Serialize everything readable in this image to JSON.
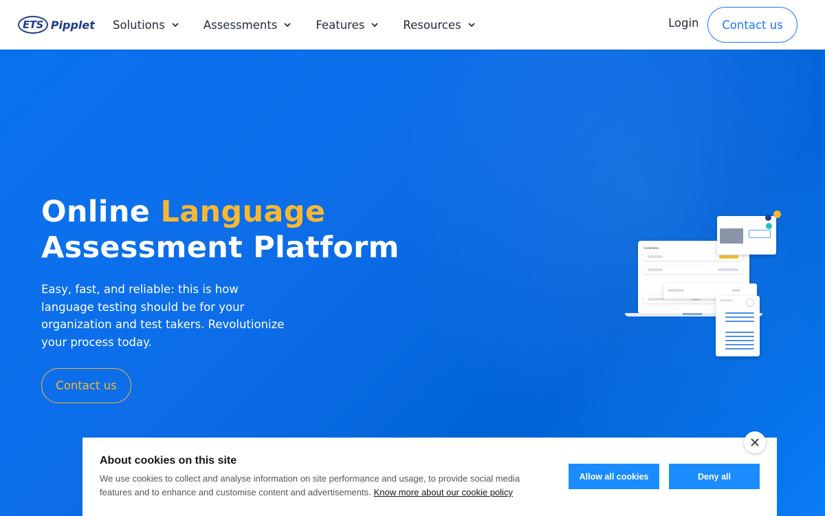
{
  "header": {
    "logo_mark": "ETS",
    "logo_text": "Pipplet",
    "nav": [
      {
        "label": "Solutions"
      },
      {
        "label": "Assessments"
      },
      {
        "label": "Features"
      },
      {
        "label": "Resources"
      }
    ],
    "login": "Login",
    "contact": "Contact us"
  },
  "hero": {
    "title_part1": "Online ",
    "title_accent": "Language",
    "title_line2": "Assessment Platform",
    "subtitle": "Easy, fast, and reliable: this is how language testing should be for your organization and test takers. Revolutionize your process today.",
    "cta": "Contact us",
    "illustration_title": "Candidates"
  },
  "cookie": {
    "title": "About cookies on this site",
    "text": "We use cookies to collect and analyse information on site performance and usage, to provide social media features and to enhance and customise content and advertisements.",
    "link": "Know more about our cookie policy",
    "allow": "Allow all cookies",
    "deny": "Deny all",
    "close_icon": "close-icon"
  },
  "colors": {
    "accent": "#f7b733",
    "primary": "#1677ff",
    "hero_bg": "#0a6fe6",
    "cookie_button": "#1a8cff"
  }
}
